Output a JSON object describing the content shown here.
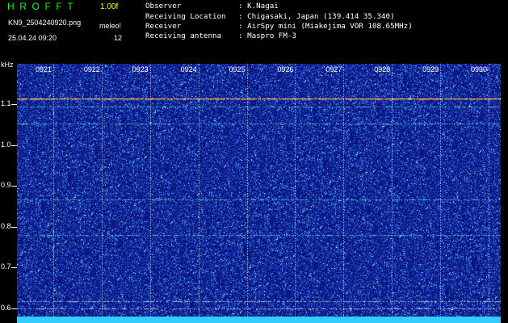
{
  "header": {
    "logo": "HROFFT",
    "version": "1.00f",
    "file_name": "KN9_2504240920.png",
    "algorithm": "meleo!",
    "datetime": "25.04.24 09:20",
    "number": "12",
    "info": [
      {
        "label": "Observer",
        "value": ": K.Nagai"
      },
      {
        "label": "Receiving Location",
        "value": ": Chigasaki, Japan (139.414 35.340)"
      },
      {
        "label": "Receiver",
        "value": ": AirSpy mini (Miakejima VOR 108.65MHz)"
      },
      {
        "label": "Receiving antenna",
        "value": ": Maspro FM-3"
      }
    ]
  },
  "chart_data": {
    "type": "heatmap",
    "yunit": "kHz",
    "time_ticks": [
      "0921",
      "0922",
      "0923",
      "0924",
      "0925",
      "0926",
      "0927",
      "0928",
      "0929",
      "0930"
    ],
    "freq_ticks": [
      "1.1",
      "1.0",
      "0.9",
      "0.8",
      "0.7",
      "0.6"
    ],
    "freq_tick_values": [
      1.1,
      1.0,
      0.9,
      0.8,
      0.7,
      0.6
    ],
    "ylim": [
      0.58,
      1.2
    ],
    "horizontal_lines_khz": [
      1.115,
      1.095,
      1.053,
      0.867,
      0.78,
      0.618,
      0.6
    ]
  },
  "colors": {
    "background": "#000000",
    "plot_blue": "#1a2fa0",
    "logo_green": "#00ff00",
    "version_yellow": "#ffff00",
    "bottom_band": "#33ccff"
  }
}
